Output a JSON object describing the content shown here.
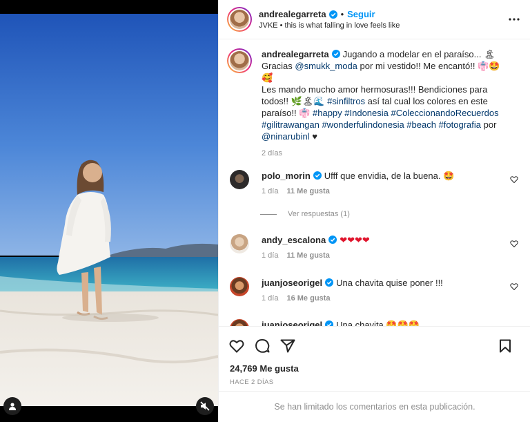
{
  "header": {
    "username": "andrealegarreta",
    "separator": "•",
    "follow_label": "Seguir",
    "song": "JVKE • this is what falling in love feels like"
  },
  "caption": {
    "username": "andrealegarreta",
    "line1": "Jugando a modelar en el paraíso... 🏝",
    "line2a": "Gracias ",
    "mention1": "@smukk_moda",
    "line2b": " por mi vestido!! Me encantó!! 👘🤩",
    "line3": "🥰",
    "line4": "Les mando mucho amor hermosuras!!! Bendiciones para todos!! 🌿🏝🌊 ",
    "hashtag1": "#sinfiltros",
    "line4b": " así tal cual los colores en este paraíso!! 👘 ",
    "hashtags": "#happy #Indonesia #ColeccionandoRecuerdos #gilitrawangan #wonderfulindonesia #beach #fotografia",
    "por": " por ",
    "mention2": "@ninarubinl",
    "heart": " ♥",
    "time": "2 días"
  },
  "comments": [
    {
      "username": "polo_morin",
      "text": "Ufff que envidia, de la buena. 🤩",
      "time": "1 día",
      "likes": "11 Me gusta"
    },
    {
      "username": "andy_escalona",
      "text": "❤❤❤❤",
      "time": "1 día",
      "likes": "11 Me gusta"
    },
    {
      "username": "juanjoseorigel",
      "text": "Una chavita quise poner !!!",
      "time": "1 día",
      "likes": "16 Me gusta"
    },
    {
      "username": "juanjoseorigel",
      "text": "Una chavita 🤩🤩🤩"
    }
  ],
  "view_replies": "Ver respuestas (1)",
  "likes_count": "24,769 Me gusta",
  "posted": "HACE 2 DÍAS",
  "comments_limited": "Se han limitado los comentarios en esta publicación.",
  "icons": {
    "verified": "verified-badge-icon",
    "more": "more-options-icon",
    "like": "heart-icon",
    "comment": "comment-bubble-icon",
    "share": "paper-plane-icon",
    "save": "bookmark-icon",
    "tag": "user-tag-icon",
    "mute": "speaker-muted-icon"
  },
  "colors": {
    "link": "#0095f6",
    "hashtag": "#00376b",
    "muted": "#8e8e8e",
    "verified": "#0095f6"
  }
}
